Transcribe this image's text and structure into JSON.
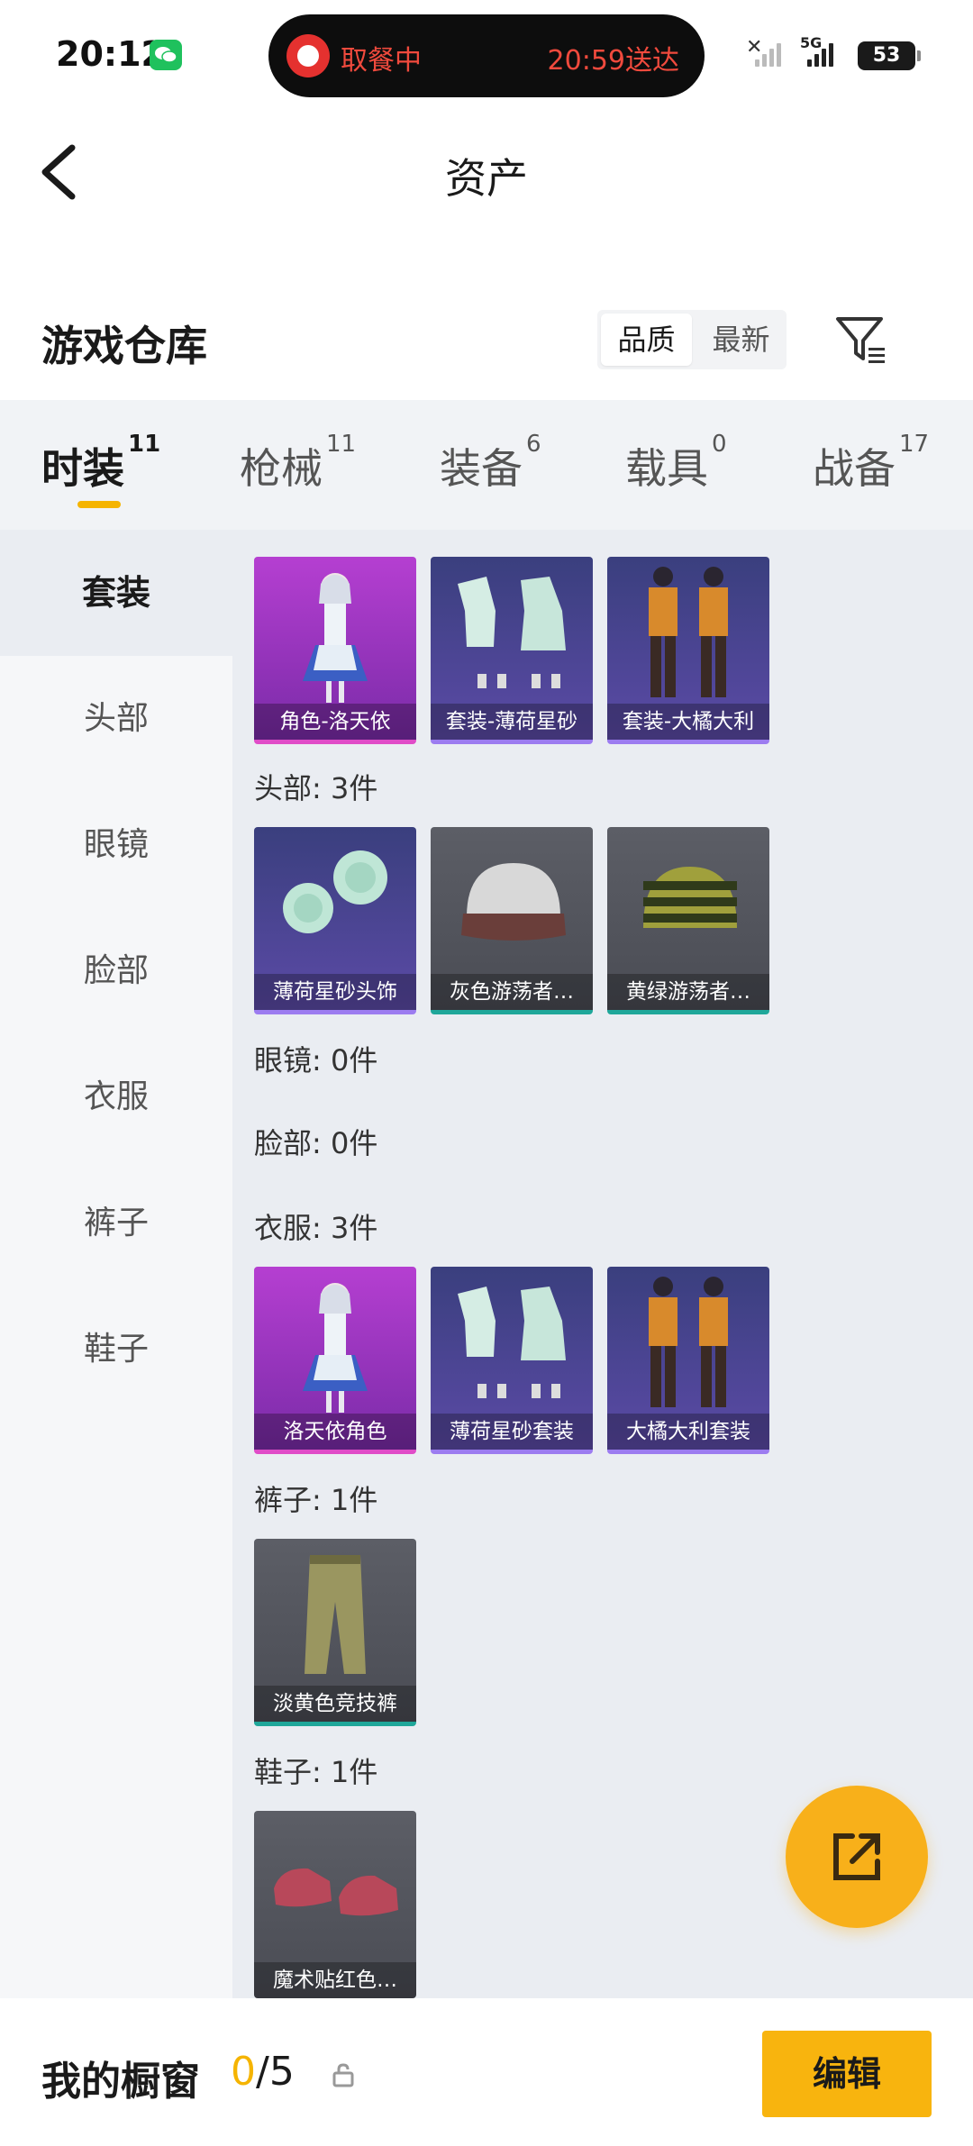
{
  "status_bar": {
    "time": "20:12",
    "island_left": "取餐中",
    "island_right": "20:59送达",
    "network": "5G",
    "battery": "53"
  },
  "header": {
    "title": "资产",
    "back_icon": "back-arrow-icon"
  },
  "section": {
    "title": "游戏仓库",
    "sort_options": [
      "品质",
      "最新"
    ],
    "sort_selected": "品质",
    "filter_icon": "filter-icon"
  },
  "tabs": [
    {
      "label": "时装",
      "count": "11"
    },
    {
      "label": "枪械",
      "count": "11"
    },
    {
      "label": "装备",
      "count": "6"
    },
    {
      "label": "载具",
      "count": "0"
    },
    {
      "label": "战备",
      "count": "17"
    }
  ],
  "sidebar": [
    "套装",
    "头部",
    "眼镜",
    "脸部",
    "衣服",
    "裤子",
    "鞋子"
  ],
  "groups": {
    "suit": [
      "角色-洛天依",
      "套装-薄荷星砂",
      "套装-大橘大利"
    ],
    "head_title": "头部: 3件",
    "head": [
      "薄荷星砂头饰",
      "灰色游荡者…",
      "黄绿游荡者…"
    ],
    "glasses_title": "眼镜: 0件",
    "face_title": "脸部: 0件",
    "clothes_title": "衣服: 3件",
    "clothes": [
      "洛天依角色",
      "薄荷星砂套装",
      "大橘大利套装"
    ],
    "pants_title": "裤子: 1件",
    "pants": [
      "淡黄色竞技裤"
    ],
    "shoes_title": "鞋子: 1件",
    "shoes": [
      "魔术贴红色…"
    ]
  },
  "colors": {
    "accent": "#f5b400",
    "pink_rarity": "#e04cc8",
    "purple_rarity": "#9c7cf0",
    "teal_rarity": "#1fa79a"
  },
  "bottom_bar": {
    "label": "我的橱窗",
    "count_current": "0",
    "count_total": "/5",
    "edit_button": "编辑"
  }
}
